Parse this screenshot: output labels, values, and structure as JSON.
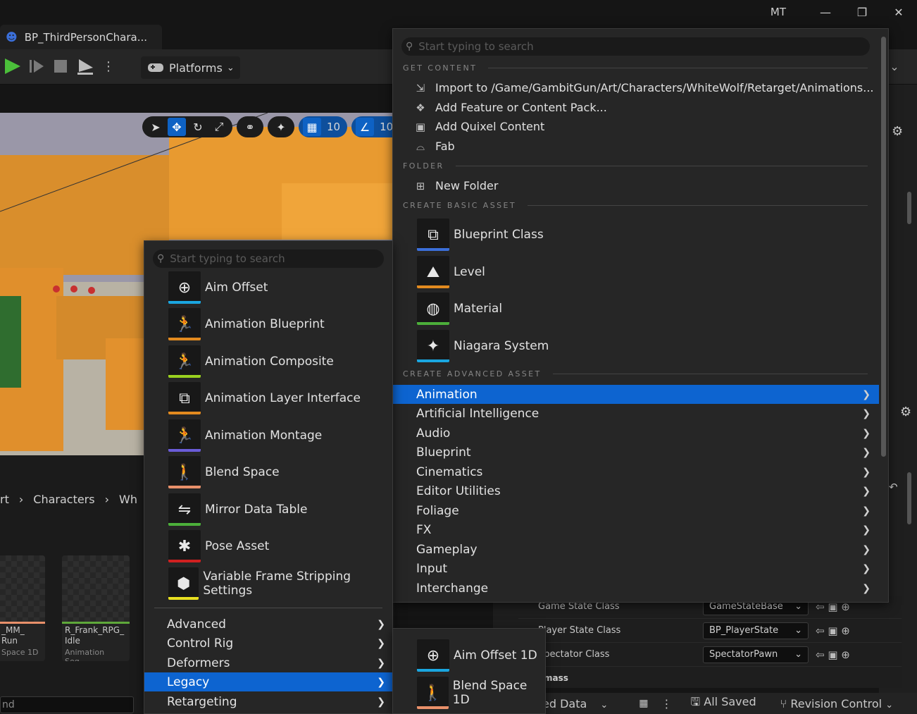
{
  "window": {
    "tab_title": "BP_ThirdPersonChara...",
    "user": "MT",
    "minimize": "—",
    "restore": "❐",
    "close": "✕"
  },
  "toolbar": {
    "platforms_label": "Platforms"
  },
  "viewport_tools": {
    "grid_value": "10",
    "angle_value": "10°"
  },
  "content_browser": {
    "breadcrumb": [
      "rt",
      "Characters",
      "Wh"
    ],
    "assets": [
      {
        "name": "_MM_\nRun",
        "type": "Space 1D"
      },
      {
        "name": "R_Frank_RPG_\nIdle",
        "type": "Animation Seq..."
      }
    ],
    "filter_text": "nd"
  },
  "details": {
    "rows": [
      {
        "label": "Game State Class",
        "value": "GameStateBase"
      },
      {
        "label": "Player State Class",
        "value": "BP_PlayerState"
      },
      {
        "label": "Spectator Class",
        "value": "SpectatorPawn"
      }
    ],
    "section": "mass"
  },
  "statusbar": {
    "derived_data": "ed Data",
    "all_saved": "All Saved",
    "revision_control": "Revision Control"
  },
  "main_menu": {
    "search_placeholder": "Start typing to search",
    "sections": {
      "get_content": "GET CONTENT",
      "folder": "FOLDER",
      "basic": "CREATE BASIC ASSET",
      "advanced": "CREATE ADVANCED ASSET"
    },
    "get_content_items": [
      {
        "label": "Import to /Game/GambitGun/Art/Characters/WhiteWolf/Retarget/Animations...",
        "icon": "import-icon"
      },
      {
        "label": "Add Feature or Content Pack...",
        "icon": "feature-pack-icon"
      },
      {
        "label": "Add Quixel Content",
        "icon": "quixel-icon"
      },
      {
        "label": "Fab",
        "icon": "fab-icon"
      }
    ],
    "folder_items": [
      {
        "label": "New Folder",
        "icon": "new-folder-icon"
      }
    ],
    "basic_assets": [
      {
        "label": "Blueprint Class",
        "color": "#3b6fd9"
      },
      {
        "label": "Level",
        "color": "#e28a1f"
      },
      {
        "label": "Material",
        "color": "#4caf3a"
      },
      {
        "label": "Niagara System",
        "color": "#1aa6e0"
      }
    ],
    "advanced_categories": [
      "Animation",
      "Artificial Intelligence",
      "Audio",
      "Blueprint",
      "Cinematics",
      "Editor Utilities",
      "Foliage",
      "FX",
      "Gameplay",
      "Input",
      "Interchange"
    ],
    "selected_category": "Animation"
  },
  "animation_submenu": {
    "search_placeholder": "Start typing to search",
    "assets": [
      {
        "label": "Aim Offset",
        "color": "#1aa6e0"
      },
      {
        "label": "Animation Blueprint",
        "color": "#e28a1f"
      },
      {
        "label": "Animation Composite",
        "color": "#9ad11f"
      },
      {
        "label": "Animation Layer Interface",
        "color": "#e28a1f"
      },
      {
        "label": "Animation Montage",
        "color": "#6a5cd8"
      },
      {
        "label": "Blend Space",
        "color": "#e8906a"
      },
      {
        "label": "Mirror Data Table",
        "color": "#4caf3a"
      },
      {
        "label": "Pose Asset",
        "color": "#d02020"
      },
      {
        "label": "Variable Frame Stripping Settings",
        "color": "#e8e020"
      }
    ],
    "categories": [
      "Advanced",
      "Control Rig",
      "Deformers",
      "Legacy",
      "Retargeting"
    ],
    "selected_category": "Legacy"
  },
  "legacy_submenu": {
    "assets": [
      {
        "label": "Aim Offset 1D",
        "color": "#1aa6e0"
      },
      {
        "label": "Blend Space 1D",
        "color": "#e8906a"
      }
    ]
  }
}
